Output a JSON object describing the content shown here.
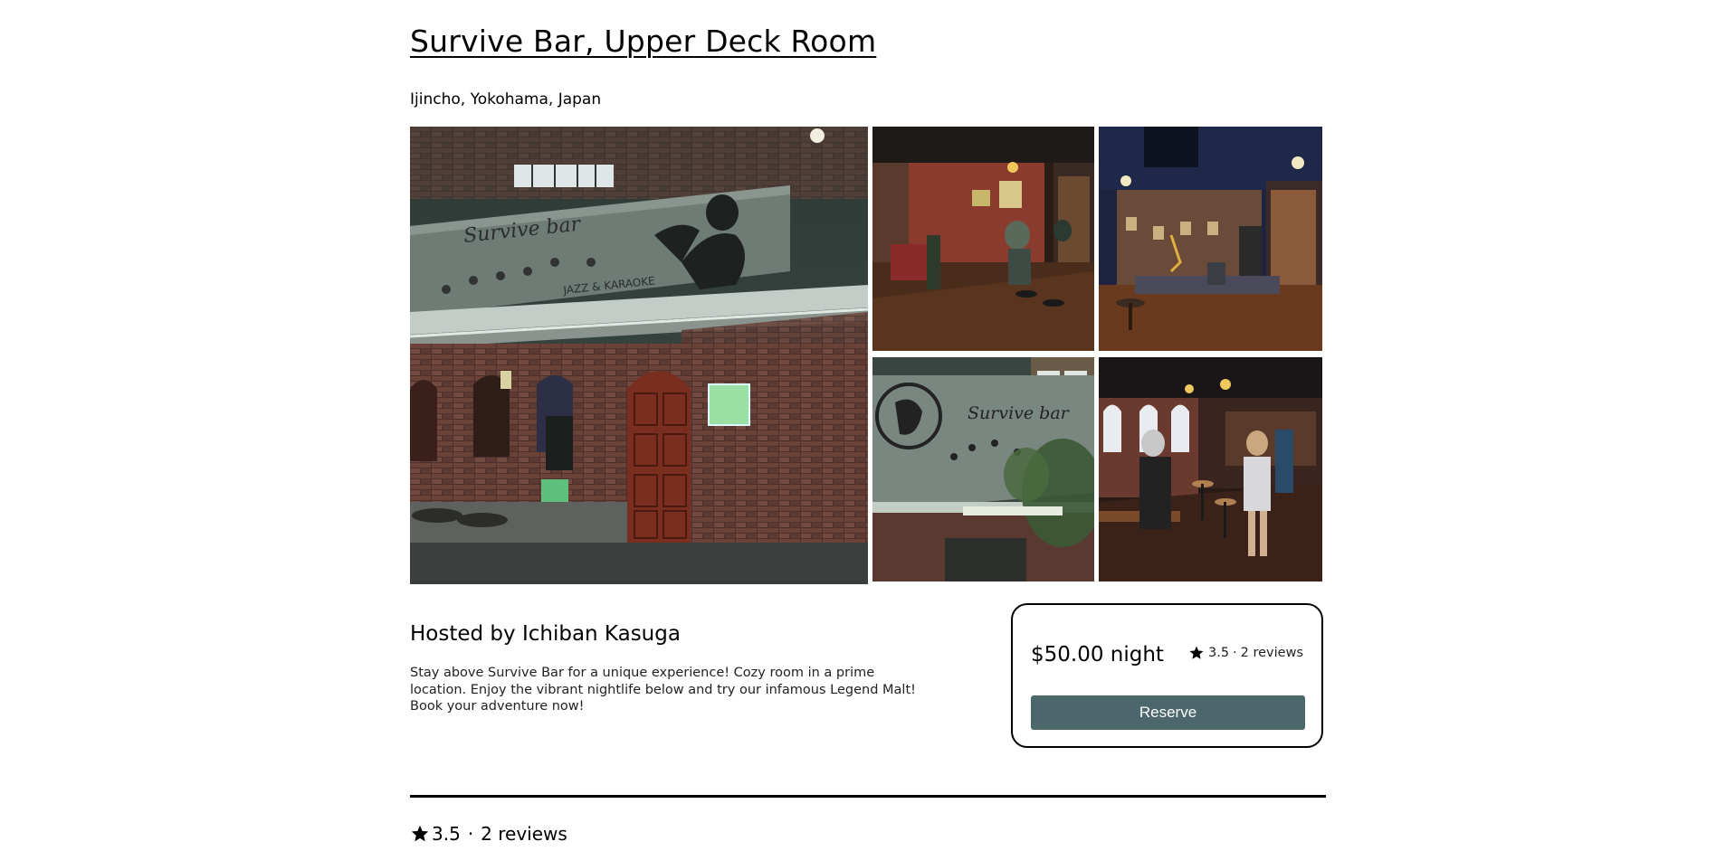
{
  "listing": {
    "title": "Survive Bar, Upper Deck Room",
    "location": "Ijincho, Yokohama, Japan"
  },
  "host": {
    "label": "Hosted by Ichiban Kasuga",
    "description": "Stay above Survive Bar for a unique experience! Cozy room in a prime location. Enjoy the vibrant nightlife below and try our infamous Legend Malt! Book your adventure now!"
  },
  "booking": {
    "price": "$50.00 night",
    "rating": "3.5",
    "separator": "·",
    "reviews": "2 reviews",
    "reserve_label": "Reserve",
    "button_color": "#4b676b"
  },
  "reviews_section": {
    "rating": "3.5",
    "separator": "·",
    "reviews": "2 reviews"
  },
  "gallery": {
    "main_sign": "Survive bar",
    "main_subsign": "JAZZ & KARAOKE",
    "side_sign": "Survive bar"
  },
  "icons": {
    "star": "star-icon"
  }
}
